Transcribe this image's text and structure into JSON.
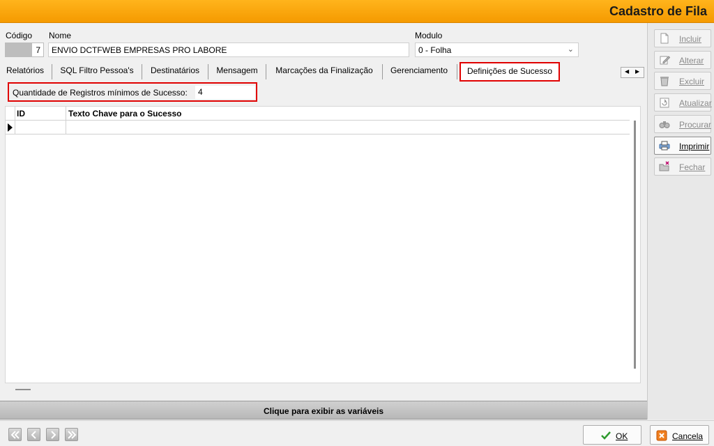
{
  "window": {
    "title": "Cadastro de Fila"
  },
  "form": {
    "codigo_label": "Código",
    "codigo_value": "7",
    "nome_label": "Nome",
    "nome_value": "ENVIO DCTFWEB EMPRESAS PRO LABORE",
    "modulo_label": "Modulo",
    "modulo_value": "0 - Folha"
  },
  "tabs": [
    {
      "label": "Relatórios"
    },
    {
      "label": "SQL Filtro Pessoa's"
    },
    {
      "label": "Destinatários"
    },
    {
      "label": "Mensagem"
    },
    {
      "label": "Marcações da Finalização"
    },
    {
      "label": "Gerenciamento"
    },
    {
      "label": "Definições de Sucesso",
      "active": true
    }
  ],
  "success": {
    "qtd_label": "Quantidade de Registros mínimos de Sucesso:",
    "qtd_value": "4"
  },
  "grid": {
    "columns": [
      "ID",
      "Texto Chave para o Sucesso"
    ],
    "rows": [
      [
        "",
        ""
      ]
    ]
  },
  "variables_bar": {
    "label": "Clique para exibir as variáveis"
  },
  "sidebar": {
    "buttons": [
      {
        "label": "Incluir",
        "icon": "new-document-icon",
        "enabled": false
      },
      {
        "label": "Alterar",
        "icon": "edit-icon",
        "enabled": false
      },
      {
        "label": "Excluir",
        "icon": "trash-icon",
        "enabled": false
      },
      {
        "label": "Atualizar",
        "icon": "refresh-icon",
        "enabled": false
      },
      {
        "label": "Procurar",
        "icon": "binoculars-icon",
        "enabled": false
      },
      {
        "label": "Imprimir",
        "icon": "printer-icon",
        "enabled": true
      },
      {
        "label": "Fechar",
        "icon": "close-folder-icon",
        "enabled": false
      }
    ]
  },
  "footer": {
    "ok_label": "OK",
    "cancel_label": "Cancela"
  },
  "colors": {
    "accent": "#f5a000",
    "highlight": "#e00000"
  }
}
